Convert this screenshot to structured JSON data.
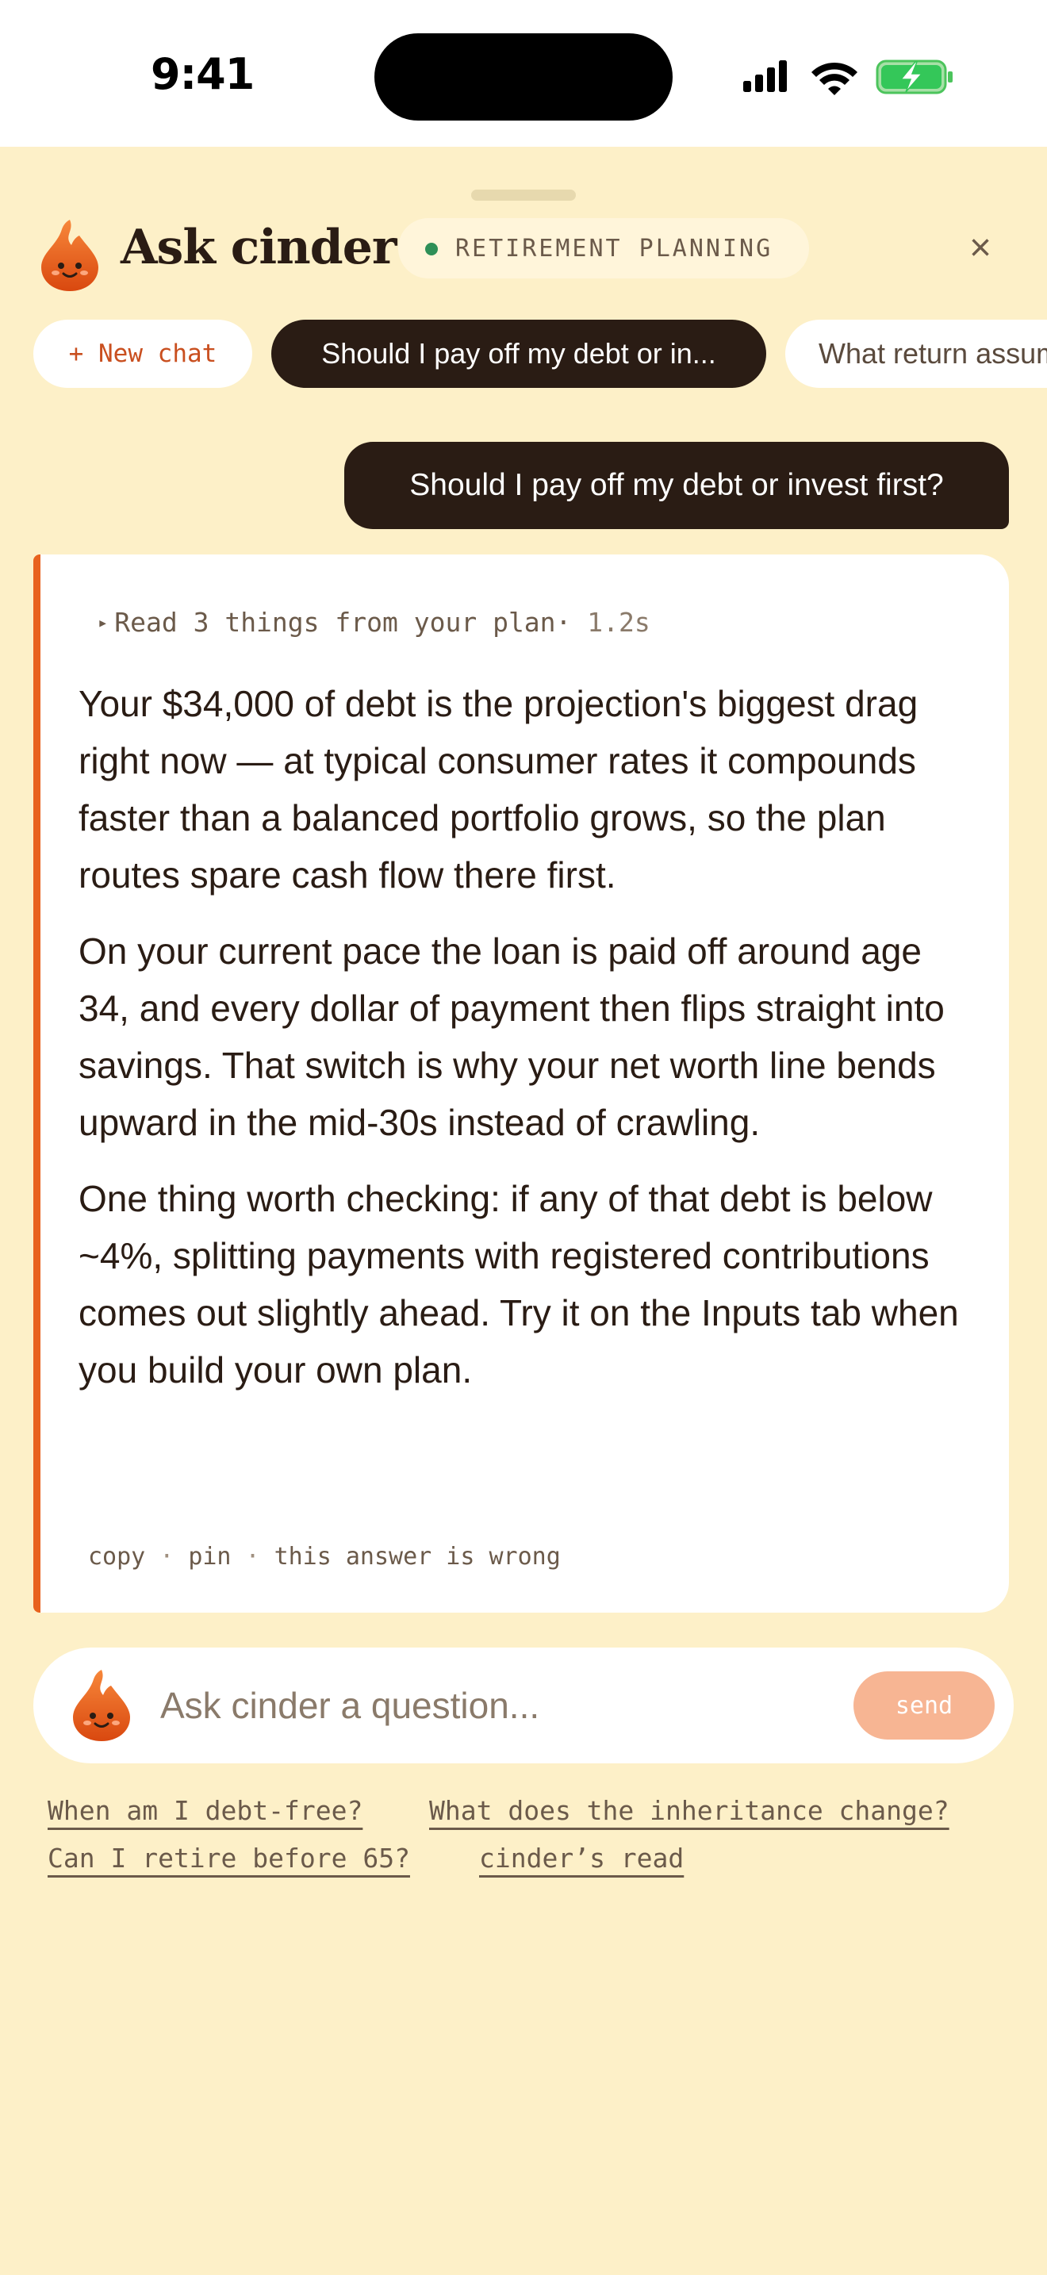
{
  "status_bar": {
    "time": "9:41"
  },
  "header": {
    "title": "Ask cinder",
    "context_label": "RETIREMENT PLANNING",
    "close_glyph": "×"
  },
  "chips": {
    "new_chat": "+ New chat",
    "active": "Should I pay off my debt or in...",
    "other": "What return assumption should I use?"
  },
  "conversation": {
    "user_message": "Should I pay off my debt or invest first?",
    "trace_label": "Read 3 things from your plan",
    "trace_separator": "·",
    "trace_duration": "1.2s",
    "paragraphs": [
      "Your $34,000 of debt is the projection's biggest drag right now — at typical consumer rates it compounds faster than a balanced portfolio grows, so the plan routes spare cash flow there first.",
      "On your current pace the loan is paid off around age 34, and every dollar of payment then flips straight into savings. That switch is why your net worth line bends upward in the mid-30s instead of crawling.",
      "One thing worth checking: if any of that debt is below ~4%, splitting payments with registered contributions comes out slightly ahead. Try it on the Inputs tab when you build your own plan."
    ],
    "actions": {
      "copy": "copy",
      "pin": "pin",
      "report": "this answer is wrong",
      "separator": "·"
    }
  },
  "composer": {
    "placeholder": "Ask cinder a question...",
    "send_label": "send"
  },
  "suggestions": [
    "When am I debt-free?",
    "What does the inheritance change?",
    "Can I retire before 65?",
    "cinder’s read"
  ],
  "colors": {
    "background": "#fdf0c8",
    "ink": "#2a1c14",
    "accent": "#e8621e",
    "status_green": "#2e8f57",
    "send_disabled": "#f7b593"
  },
  "icons": {
    "logo": "flame-mascot-icon",
    "signal": "cellular-signal-icon",
    "wifi": "wifi-icon",
    "battery": "battery-charging-icon",
    "close": "close-icon",
    "trace": "triangle-right-icon"
  }
}
